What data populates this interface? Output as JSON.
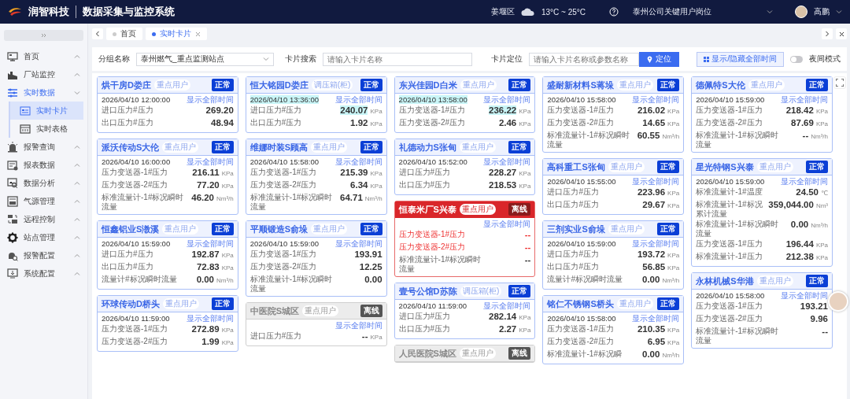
{
  "header": {
    "brand": "润智科技",
    "title": "数据采集与监控系统",
    "district": "姜堰区",
    "weather": "13°C ~ 25°C",
    "role": "泰州公司关键用户岗位",
    "user": "高鹏"
  },
  "sidebar": {
    "items": [
      {
        "label": "首页",
        "expanded": false
      },
      {
        "label": "厂站监控",
        "expanded": false
      },
      {
        "label": "实时数据",
        "expanded": true,
        "children": [
          {
            "label": "实时卡片",
            "selected": true
          },
          {
            "label": "实时表格",
            "selected": false
          }
        ]
      },
      {
        "label": "报警查询",
        "expanded": false
      },
      {
        "label": "报表数据",
        "expanded": false
      },
      {
        "label": "数据分析",
        "expanded": false
      },
      {
        "label": "气源管理",
        "expanded": false
      },
      {
        "label": "远程控制",
        "expanded": false
      },
      {
        "label": "站点管理",
        "expanded": false
      },
      {
        "label": "报警配置",
        "expanded": false
      },
      {
        "label": "系统配置",
        "expanded": false
      }
    ]
  },
  "tabs": [
    {
      "label": "首页",
      "selected": false,
      "closable": false
    },
    {
      "label": "实时卡片",
      "selected": true,
      "closable": true
    }
  ],
  "filters": {
    "group_label": "分组名称",
    "group_value": "泰州燃气_重点监测站点",
    "search_label": "卡片搜索",
    "search_placeholder": "请输入卡片名称",
    "locate_label": "卡片定位",
    "locate_placeholder": "请输入卡片名称或参数名称",
    "locate_button": "定位",
    "toggle_time_button": "显示/隐藏全部时间",
    "night_mode": {
      "label": "夜间模式",
      "on": false
    }
  },
  "card_columns": [
    [
      {
        "title": "烘干房D娄庄",
        "tag": "重点用户",
        "status": "正常",
        "kind": "normal",
        "time": "2026/04/10 12:00:00",
        "time_highlighted": false,
        "link": "显示全部时间",
        "rows": [
          {
            "label": "进口压力#压力",
            "value": "269.20"
          },
          {
            "label": "出口压力#压力",
            "value": "48.94"
          }
        ]
      },
      {
        "title": "派沃传动S大伦",
        "tag": "重点用户",
        "status": "正常",
        "kind": "normal",
        "time": "2026/04/10 16:00:00",
        "time_highlighted": false,
        "link": "显示全部时间",
        "rows": [
          {
            "label": "压力变送器-1#压力",
            "value": "216.11",
            "unit": "KPa"
          },
          {
            "label": "压力变送器-2#压力",
            "value": "77.20",
            "unit": "KPa"
          },
          {
            "label": "标准流量计-1#标况瞬时流量",
            "value": "46.20",
            "unit": "Nm³/h"
          }
        ]
      },
      {
        "title": "恒鑫铝业S漖溪",
        "tag": "重点用户",
        "status": "正常",
        "kind": "normal",
        "time": "2026/04/10 15:59:00",
        "time_highlighted": false,
        "link": "显示全部时间",
        "rows": [
          {
            "label": "进口压力#压力",
            "value": "192.87",
            "unit": "KPa"
          },
          {
            "label": "出口压力#压力",
            "value": "72.83",
            "unit": "KPa"
          },
          {
            "label": "流量计#标况瞬时流量",
            "value": "0.00",
            "unit": "Nm³/h"
          }
        ]
      },
      {
        "title": "环球传动D桥头",
        "tag": "重点用户",
        "status": "正常",
        "kind": "normal",
        "time": "2026/04/10 11:59:00",
        "time_highlighted": false,
        "link": "显示全部时间",
        "rows": [
          {
            "label": "压力变送器-1#压力",
            "value": "272.89",
            "unit": "KPa"
          },
          {
            "label": "压力变送器-2#压力",
            "value": "1.99",
            "unit": "KPa"
          }
        ]
      }
    ],
    [
      {
        "title": "恒大铭园D娄庄",
        "tag": "调压箱(柜)",
        "status": "正常",
        "kind": "normal",
        "time": "2026/04/10 13:36:00",
        "time_highlighted": true,
        "link": "显示全部时间",
        "rows": [
          {
            "label": "进口压力#压力",
            "value": "240.07",
            "unit": "KPa",
            "highlighted": true
          },
          {
            "label": "出口压力#压力",
            "value": "1.92",
            "unit": "KPa",
            "highlighted": false
          }
        ]
      },
      {
        "title": "维娜时装S顾高",
        "tag": "重点用户",
        "status": "正常",
        "kind": "normal",
        "time": "2026/04/10 15:58:00",
        "time_highlighted": false,
        "link": "显示全部时间",
        "rows": [
          {
            "label": "压力变送器-1#压力",
            "value": "215.39",
            "unit": "KPa"
          },
          {
            "label": "压力变送器-2#压力",
            "value": "6.34",
            "unit": "KPa"
          },
          {
            "label": "标准流量计-1#标况瞬时流量",
            "value": "64.71",
            "unit": "Nm³/h"
          }
        ]
      },
      {
        "title": "平顺锻造S俞垛",
        "tag": "重点用户",
        "status": "正常",
        "kind": "normal",
        "time": "2026/04/10 15:59:00",
        "time_highlighted": false,
        "link": "显示全部时间",
        "rows": [
          {
            "label": "压力变送器-1#压力",
            "value": "193.91"
          },
          {
            "label": "压力变送器-2#压力",
            "value": "12.25"
          },
          {
            "label": "标准流量计-1#标况瞬时流量",
            "value": "0.00"
          }
        ]
      },
      {
        "title": "中医院S城区",
        "tag": "重点用户",
        "status": "离线",
        "kind": "offline",
        "link": "显示全部时间",
        "rows": [
          {
            "label": "进口压力#压力",
            "value": "--",
            "unit": "KPa"
          }
        ]
      }
    ],
    [
      {
        "title": "东兴佳园D白米",
        "tag": "重点用户",
        "status": "正常",
        "kind": "normal",
        "time": "2026/04/10 13:58:00",
        "time_highlighted": true,
        "link": "显示全部时间",
        "rows": [
          {
            "label": "压力变送器-1#压力",
            "value": "236.22",
            "unit": "KPa",
            "highlighted": true
          },
          {
            "label": "压力变送器-2#压力",
            "value": "2.46",
            "unit": "KPa",
            "highlighted": false
          }
        ]
      },
      {
        "title": "礼德动力S张甸",
        "tag": "重点用户",
        "status": "正常",
        "kind": "normal",
        "time": "2026/04/10 15:52:00",
        "time_highlighted": false,
        "link": "显示全部时间",
        "rows": [
          {
            "label": "进口压力#压力",
            "value": "228.27",
            "unit": "KPa"
          },
          {
            "label": "出口压力#压力",
            "value": "218.53",
            "unit": "KPa"
          }
        ]
      },
      {
        "title": "恒泰米厂S兴泰",
        "tag": "重点用户",
        "status": "离线",
        "kind": "alarm",
        "link": "显示全部时间",
        "rows": [
          {
            "label": "压力变送器-1#压力",
            "value": "--",
            "alert": true
          },
          {
            "label": "压力变送器-2#压力",
            "value": "--",
            "alert": true
          },
          {
            "label": "标准流量计-1#标况瞬时流量",
            "value": "--",
            "alert": false
          }
        ]
      },
      {
        "title": "壹号公馆D苏陈",
        "tag": "调压箱(柜)",
        "status": "正常",
        "kind": "normal",
        "time": "2026/04/10 11:59:00",
        "time_highlighted": false,
        "link": "显示全部时间",
        "rows": [
          {
            "label": "进口压力#压力",
            "value": "282.14",
            "unit": "KPa"
          },
          {
            "label": "出口压力#压力",
            "value": "2.27",
            "unit": "KPa"
          }
        ]
      },
      {
        "title": "人民医院S城区",
        "tag": "重点用户",
        "status": "离线",
        "kind": "offline"
      }
    ],
    [
      {
        "title": "盛耐新材料S蒋垛",
        "tag": "重点用户",
        "status": "正常",
        "kind": "normal",
        "time": "2026/04/10 15:58:00",
        "time_highlighted": false,
        "link": "显示全部时间",
        "rows": [
          {
            "label": "压力变送器-1#压力",
            "value": "216.02",
            "unit": "KPa"
          },
          {
            "label": "压力变送器-2#压力",
            "value": "14.65",
            "unit": "KPa"
          },
          {
            "label": "标准流量计-1#标况瞬时流量",
            "value": "60.55",
            "unit": "Nm³/h"
          }
        ]
      },
      {
        "title": "高科重工S张甸",
        "tag": "重点用户",
        "status": "正常",
        "kind": "normal",
        "time": "2026/04/10 15:55:00",
        "time_highlighted": false,
        "link": "显示全部时间",
        "rows": [
          {
            "label": "进口压力#压力",
            "value": "223.96",
            "unit": "KPa"
          },
          {
            "label": "出口压力#压力",
            "value": "29.67",
            "unit": "KPa"
          }
        ]
      },
      {
        "title": "三剂实业S俞垛",
        "tag": "重点用户",
        "status": "正常",
        "kind": "normal",
        "time": "2026/04/10 15:59:00",
        "time_highlighted": false,
        "link": "显示全部时间",
        "rows": [
          {
            "label": "进口压力#压力",
            "value": "193.72",
            "unit": "KPa"
          },
          {
            "label": "出口压力#压力",
            "value": "56.85",
            "unit": "KPa"
          },
          {
            "label": "流量计#标况瞬时流量",
            "value": "0.00",
            "unit": "Nm³/h"
          }
        ]
      },
      {
        "title": "铭仁不锈钢S桥头",
        "tag": "重点用户",
        "status": "正常",
        "kind": "normal",
        "time": "2026/04/10 15:58:00",
        "time_highlighted": false,
        "link": "显示全部时间",
        "rows": [
          {
            "label": "压力变送器-1#压力",
            "value": "210.35",
            "unit": "KPa"
          },
          {
            "label": "压力变送器-2#压力",
            "value": "6.95",
            "unit": "KPa"
          },
          {
            "label": "标准流量计-1#标况瞬",
            "value": "0.00",
            "unit": "Nm³/h"
          }
        ]
      }
    ],
    [
      {
        "title": "德佩特S大伦",
        "tag": "重点用户",
        "status": "正常",
        "kind": "normal",
        "time": "2026/04/10 15:59:00",
        "time_highlighted": false,
        "link": "显示全部时间",
        "rows": [
          {
            "label": "压力变送器-1#压力",
            "value": "218.42",
            "unit": "KPa"
          },
          {
            "label": "压力变送器-2#压力",
            "value": "87.69",
            "unit": "KPa"
          },
          {
            "label": "标准流量计-1#标况瞬时流量",
            "value": "--",
            "unit": "Nm³/h"
          }
        ]
      },
      {
        "title": "星光特钢S兴泰",
        "tag": "重点用户",
        "status": "正常",
        "kind": "normal",
        "time": "2026/04/10 15:59:00",
        "time_highlighted": false,
        "link": "显示全部时间",
        "rows": [
          {
            "label": "标准流量计-1#温度",
            "value": "24.50",
            "unit": "℃"
          },
          {
            "label": "标准流量计-1#标况累计流量",
            "value": "359,044.00",
            "unit": "Nm³"
          },
          {
            "label": "标准流量计-1#标况瞬时流量",
            "value": "0.00",
            "unit": "Nm³/h"
          },
          {
            "label": "压力变送器-1#压力",
            "value": "196.44",
            "unit": "KPa"
          },
          {
            "label": "标准流量计-1#压力",
            "value": "212.38",
            "unit": "KPa"
          }
        ]
      },
      {
        "title": "永林机械S华港",
        "tag": "重点用户",
        "status": "正常",
        "kind": "normal",
        "time": "2026/04/10 15:58:00",
        "time_highlighted": false,
        "link": "显示全部时间",
        "rows": [
          {
            "label": "压力变送器-1#压力",
            "value": "193.21"
          },
          {
            "label": "压力变送器-2#压力",
            "value": "9.96"
          },
          {
            "label": "标准流量计-1#标况瞬时流量",
            "value": "--"
          }
        ]
      }
    ]
  ]
}
